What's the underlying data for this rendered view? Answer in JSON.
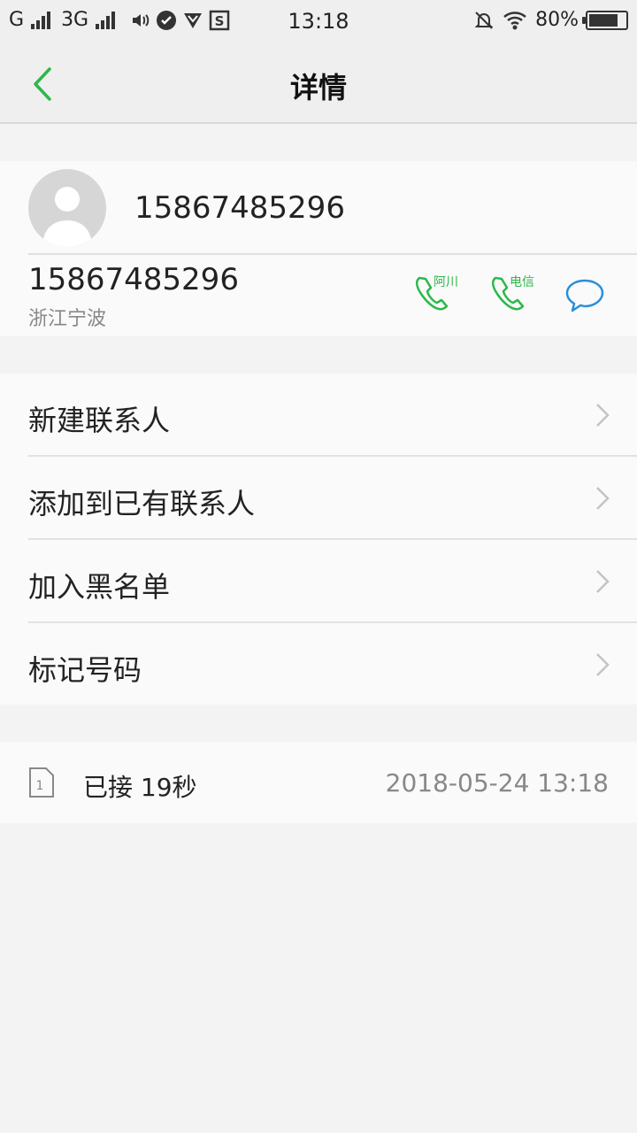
{
  "status_bar": {
    "carrier1": "G",
    "carrier2": "3G",
    "time": "13:18",
    "battery_text": "80%",
    "battery_level": 0.8
  },
  "header": {
    "title": "详情"
  },
  "contact": {
    "display_name": "15867485296",
    "number": "15867485296",
    "location": "浙江宁波",
    "actions": [
      {
        "label": "阿川",
        "icon": "phone-icon"
      },
      {
        "label": "电信",
        "icon": "phone-icon"
      },
      {
        "label": "",
        "icon": "message-icon"
      }
    ]
  },
  "menu": {
    "items": [
      {
        "label": "新建联系人"
      },
      {
        "label": "添加到已有联系人"
      },
      {
        "label": "加入黑名单"
      },
      {
        "label": "标记号码"
      }
    ]
  },
  "call_log": {
    "sim": "1",
    "description": "已接 19秒",
    "datetime": "2018-05-24 13:18"
  },
  "colors": {
    "accent_green": "#2cb84a",
    "message_blue": "#2a8fd8"
  }
}
